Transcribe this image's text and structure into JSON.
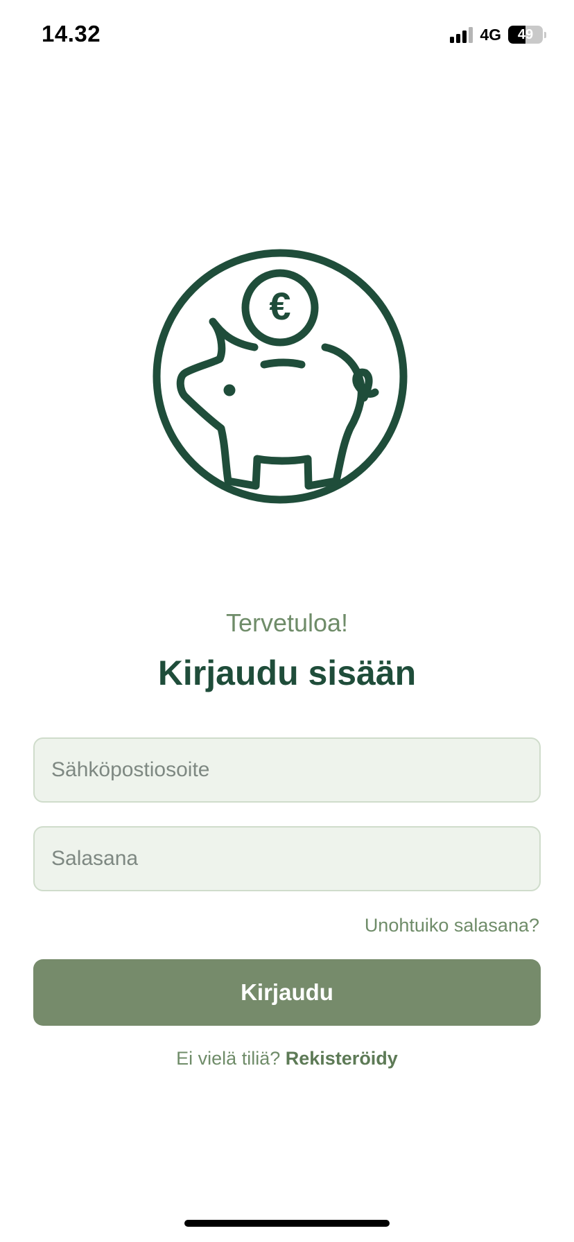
{
  "status_bar": {
    "time": "14.32",
    "network": "4G",
    "battery_level": "49",
    "battery_fraction": 0.49,
    "signal_bars_active": 3,
    "signal_bars_total": 4
  },
  "logo": {
    "icon": "piggy-bank-euro-icon",
    "color": "#1f4d3a",
    "coin_symbol": "€"
  },
  "header": {
    "welcome": "Tervetuloa!",
    "title": "Kirjaudu sisään"
  },
  "form": {
    "email_placeholder": "Sähköpostiosoite",
    "email_value": "",
    "password_placeholder": "Salasana",
    "password_value": "",
    "forgot_password": "Unohtuiko salasana?",
    "submit_label": "Kirjaudu"
  },
  "register": {
    "prompt": "Ei vielä tiliä?",
    "link": "Rekisteröidy"
  },
  "colors": {
    "primary_dark": "#1f4d3a",
    "accent": "#6f8c69",
    "button": "#768b6b",
    "field_bg": "#eef3ec"
  }
}
